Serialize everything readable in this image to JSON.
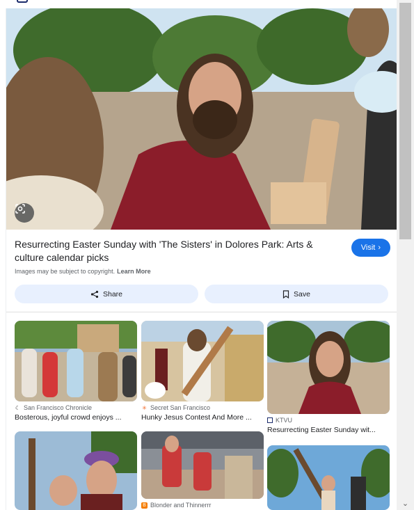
{
  "result": {
    "title": "Resurrecting Easter Sunday with 'The Sisters' in Dolores Park: Arts & culture calendar picks",
    "visit_label": "Visit",
    "copyright_text": "Images may be subject to copyright.",
    "learn_more": "Learn More",
    "share_label": "Share",
    "save_label": "Save"
  },
  "related": [
    {
      "source": "San Francisco Chronicle",
      "caption": "Bosterous, joyful crowd enjoys ...",
      "source_icon": "moon-icon",
      "accent": "#1a1a1a"
    },
    {
      "source": "Secret San Francisco",
      "caption": "Hunky Jesus Contest And More ...",
      "source_icon": "asterisk-icon",
      "accent": "#f26522"
    },
    {
      "source": "KTVU",
      "caption": "Resurrecting Easter Sunday wit...",
      "source_icon": "ktvu-icon",
      "accent": "#1a2b6b"
    },
    {
      "source": "",
      "caption": "",
      "source_icon": "",
      "accent": ""
    },
    {
      "source": "Blonder and Thinnerrr",
      "caption": "",
      "source_icon": "blogger-icon",
      "accent": "#f57d00"
    },
    {
      "source": "",
      "caption": "",
      "source_icon": "",
      "accent": ""
    }
  ],
  "colors": {
    "primary": "#1a73e8",
    "chip": "#e8f0fe"
  }
}
